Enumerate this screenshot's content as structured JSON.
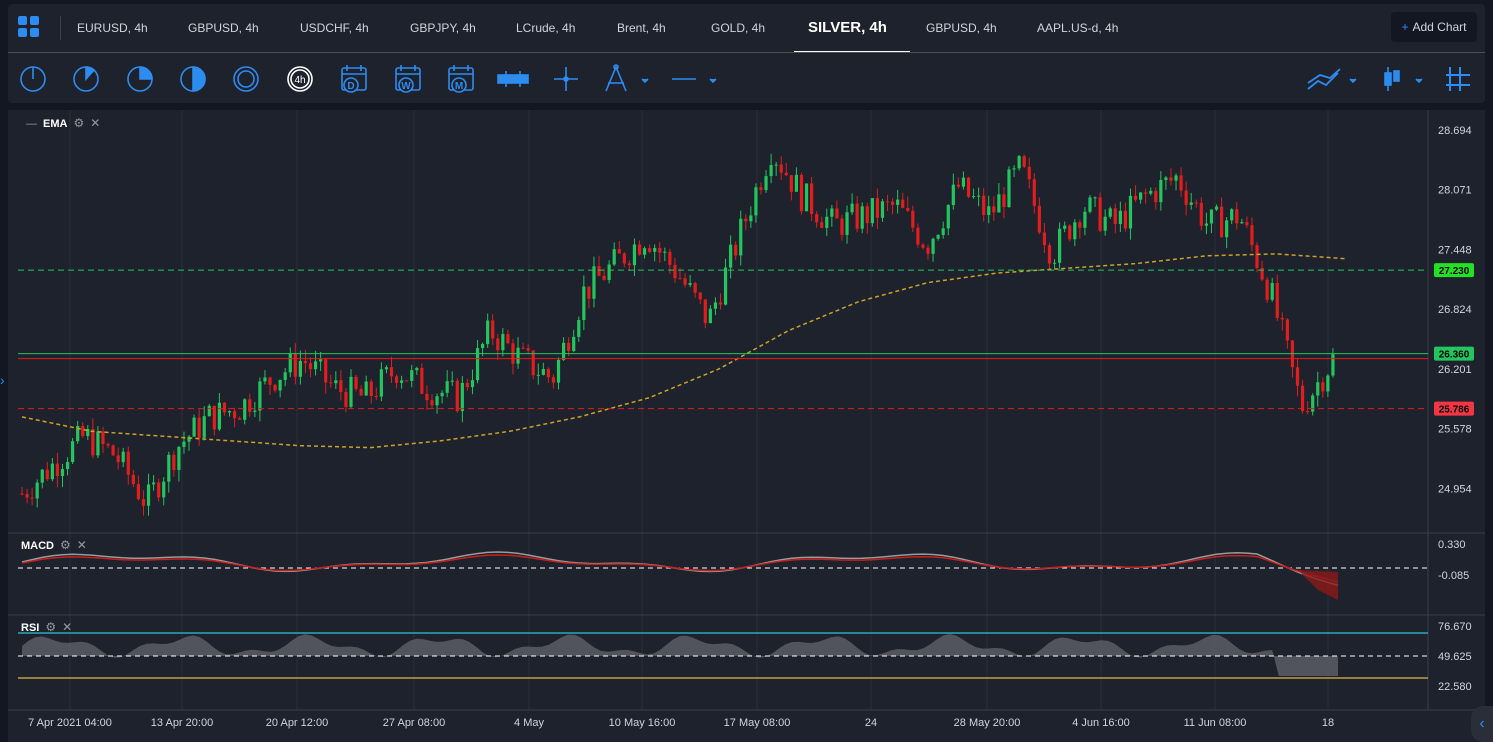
{
  "tabs": [
    "EURUSD, 4h",
    "GBPUSD, 4h",
    "USDCHF, 4h",
    "GBPJPY, 4h",
    "LCrude, 4h",
    "Brent, 4h",
    "GOLD, 4h",
    "SILVER, 4h",
    "GBPUSD, 4h",
    "AAPL.US-d, 4h"
  ],
  "active_tab": "SILVER, 4h",
  "add_chart": "Add Chart",
  "add_chart_icon": "+",
  "timeframe_badge": "4h",
  "icons": {
    "layouts": "grid-icon",
    "tools": [
      "1m-icon",
      "5m-icon",
      "15m-icon",
      "30m-icon",
      "1h-icon",
      "4h-icon",
      "daily-calendar-icon",
      "weekly-calendar-icon",
      "monthly-calendar-icon",
      "range-icon",
      "crosshair-icon",
      "drawing-icon",
      "line-icon"
    ],
    "right": [
      "indicator-icon",
      "candle-type-icon",
      "gridlines-icon"
    ]
  },
  "calendar_letters": [
    "D",
    "W",
    "M"
  ],
  "panels": {
    "main": {
      "name": "EMA"
    },
    "macd": {
      "name": "MACD"
    },
    "rsi": {
      "name": "RSI"
    }
  },
  "colors": {
    "accent": "#2d8cf0",
    "up": "#22c55e",
    "down": "#e11d1d",
    "ema": "#c9a227"
  },
  "chart_data": {
    "type": "candlestick",
    "symbol": "SILVER, 4h",
    "price_axis": [
      "28.694",
      "28.071",
      "27.448",
      "26.824",
      "26.201",
      "25.578",
      "24.954"
    ],
    "ylim": [
      24.5,
      28.9
    ],
    "ema_values": [
      25.7,
      25.55,
      25.5,
      25.45,
      25.4,
      25.38,
      25.45,
      25.55,
      25.7,
      25.9,
      26.2,
      26.6,
      26.9,
      27.1,
      27.2,
      27.25,
      27.3,
      27.38,
      27.4,
      27.35
    ],
    "close_path": [
      24.9,
      25.2,
      25.5,
      25.3,
      24.8,
      25.4,
      25.7,
      25.8,
      26.1,
      26.3,
      26.0,
      25.9,
      26.2,
      26.0,
      25.9,
      26.6,
      26.3,
      26.1,
      27.0,
      27.3,
      27.6,
      27.2,
      26.7,
      27.6,
      28.5,
      28.0,
      27.7,
      27.8,
      27.9,
      27.5,
      28.1,
      27.8,
      28.3,
      27.4,
      27.9,
      27.7,
      28.0,
      28.2,
      27.7,
      27.8,
      27.0,
      25.8,
      26.3
    ],
    "levels": {
      "resistance": "27.230",
      "current": "26.360",
      "support": "25.786"
    },
    "time_axis": [
      "7 Apr 2021 04:00",
      "13 Apr 20:00",
      "20 Apr 12:00",
      "27 Apr 08:00",
      "4 May",
      "10 May 16:00",
      "17 May 08:00",
      "24",
      "28 May 20:00",
      "4 Jun 16:00",
      "11 Jun 08:00",
      "18"
    ],
    "macd_axis": [
      "0.330",
      "-0.085"
    ],
    "rsi_axis": [
      "76.670",
      "49.625",
      "22.580"
    ]
  }
}
